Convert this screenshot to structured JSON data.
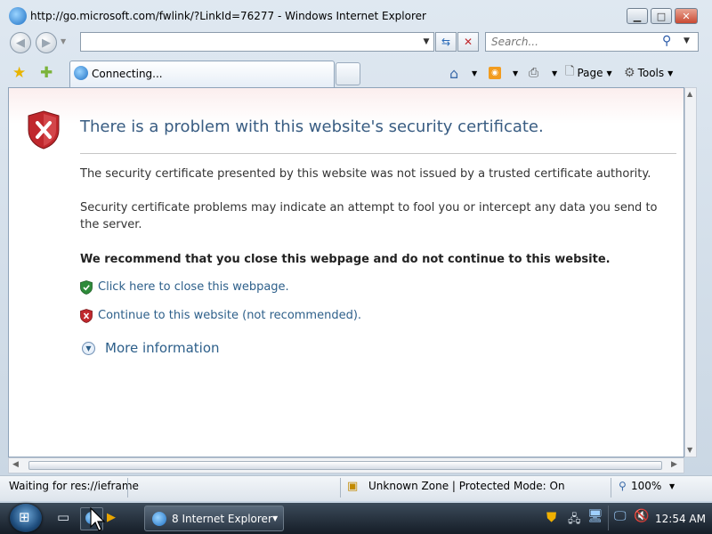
{
  "window": {
    "title": "http://go.microsoft.com/fwlink/?LinkId=76277 - Windows Internet Explorer",
    "minimize": "▁",
    "maximize": "□",
    "close": "✕"
  },
  "nav": {
    "address_value": "",
    "search_placeholder": "Search..."
  },
  "tab": {
    "label": "Connecting..."
  },
  "toolbar": {
    "page_label": "Page",
    "tools_label": "Tools"
  },
  "content": {
    "heading": "There is a problem with this website's security certificate.",
    "para1": "The security certificate presented by this website was not issued by a trusted certificate authority.",
    "para2": "Security certificate problems may indicate an attempt to fool you or intercept any data you send to the server.",
    "recommend": "We recommend that you close this webpage and do not continue to this website.",
    "close_link": "Click here to close this webpage.",
    "continue_link": "Continue to this website (not recommended).",
    "more_info": "More information"
  },
  "status": {
    "text": "Waiting for res://ieframe",
    "zone": "Unknown Zone | Protected Mode: On",
    "zoom": "100%"
  },
  "taskbar": {
    "ie_task_label": "8 Internet Explorer",
    "clock": "12:54 AM"
  },
  "colors": {
    "heading": "#385c82",
    "link": "#2d5f8a",
    "shield_red": "#c0282d",
    "shield_green": "#2e8b3a"
  }
}
